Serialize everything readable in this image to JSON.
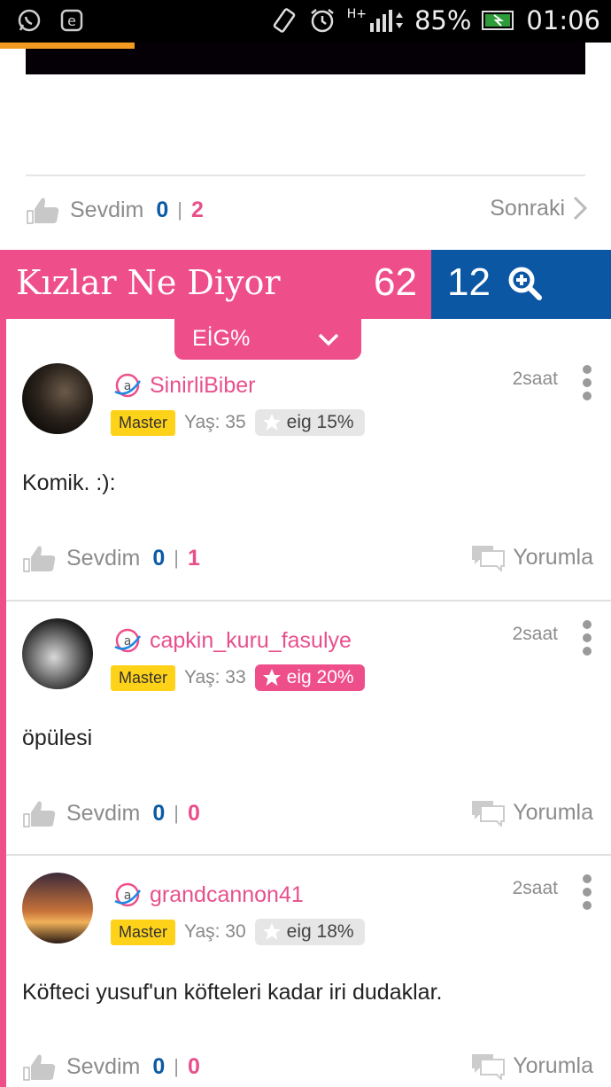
{
  "statusbar": {
    "battery": "85%",
    "time": "01:06",
    "network": "H+",
    "icons": [
      "whatsapp-icon",
      "e-app-icon",
      "rotate-icon",
      "alarm-icon",
      "signal-icon",
      "battery-icon"
    ]
  },
  "post_actions": {
    "like_label": "Sevdim",
    "like_count": "0",
    "separator": "|",
    "dislike_count": "2",
    "next_label": "Sonraki"
  },
  "banner": {
    "title": "Kızlar Ne Diyor",
    "girls_count": "62",
    "other_count": "12"
  },
  "filter": {
    "label": "EİG%"
  },
  "comments": [
    {
      "username": "SinirliBiber",
      "rank": "Master",
      "age": "Yaş: 35",
      "eig": "eig 15%",
      "eig_style": "grey",
      "time": "2saat",
      "text": "Komik. :):",
      "like_label": "Sevdim",
      "like_count": "0",
      "separator": "|",
      "dislike_count": "1",
      "reply_label": "Yorumla"
    },
    {
      "username": "capkin_kuru_fasulye",
      "rank": "Master",
      "age": "Yaş: 33",
      "eig": "eig 20%",
      "eig_style": "pink",
      "time": "2saat",
      "text": "öpülesi",
      "like_label": "Sevdim",
      "like_count": "0",
      "separator": "|",
      "dislike_count": "0",
      "reply_label": "Yorumla"
    },
    {
      "username": "grandcannon41",
      "rank": "Master",
      "age": "Yaş: 30",
      "eig": "eig 18%",
      "eig_style": "grey",
      "time": "2saat",
      "text": "Köfteci yusuf'un köfteleri kadar iri dudaklar.",
      "like_label": "Sevdim",
      "like_count": "0",
      "separator": "|",
      "dislike_count": "0",
      "reply_label": "Yorumla"
    }
  ],
  "colors": {
    "pink": "#ee4f8b",
    "blue": "#0b57a4",
    "master_badge": "#ffd21a"
  }
}
